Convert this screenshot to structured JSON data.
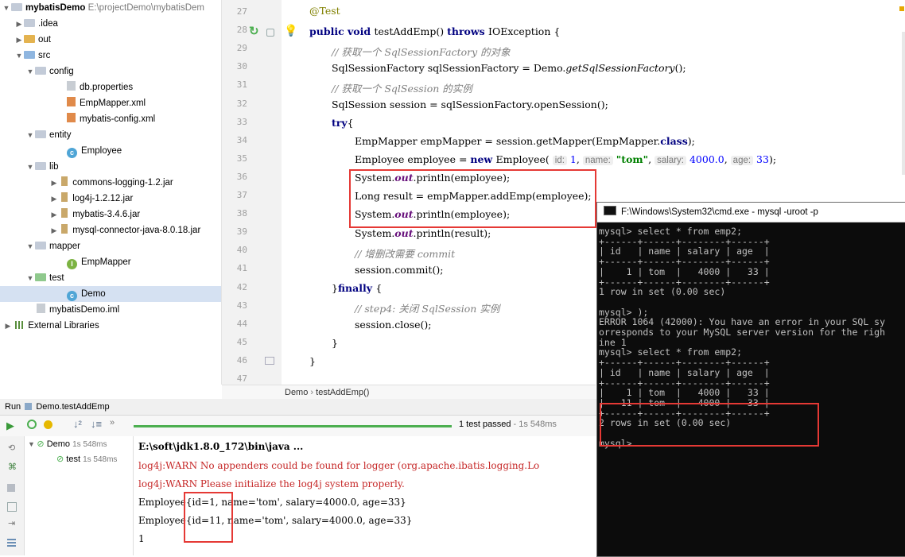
{
  "project": {
    "name": "mybatisDemo",
    "path": "E:\\projectDemo\\mybatisDem",
    "items": [
      {
        "label": ".idea"
      },
      {
        "label": "out"
      },
      {
        "label": "src"
      },
      {
        "label": "config"
      },
      {
        "label": "db.properties"
      },
      {
        "label": "EmpMapper.xml"
      },
      {
        "label": "mybatis-config.xml"
      },
      {
        "label": "entity"
      },
      {
        "label": "Employee"
      },
      {
        "label": "lib"
      },
      {
        "label": "commons-logging-1.2.jar"
      },
      {
        "label": "log4j-1.2.12.jar"
      },
      {
        "label": "mybatis-3.4.6.jar"
      },
      {
        "label": "mysql-connector-java-8.0.18.jar"
      },
      {
        "label": "mapper"
      },
      {
        "label": "EmpMapper"
      },
      {
        "label": "test"
      },
      {
        "label": "Demo"
      },
      {
        "label": "mybatisDemo.iml"
      },
      {
        "label": "External Libraries"
      }
    ]
  },
  "editor": {
    "line_numbers": [
      "27",
      "28",
      "29",
      "30",
      "31",
      "32",
      "33",
      "34",
      "35",
      "36",
      "37",
      "38",
      "39",
      "40",
      "41",
      "42",
      "43",
      "44",
      "45",
      "46",
      "47"
    ],
    "code": {
      "l27": "@Test",
      "l28a": "public void ",
      "l28b": "testAddEmp() ",
      "l28c": "throws ",
      "l28d": "IOException {",
      "l29": "// 获取一个 SqlSessionFactory 的对象",
      "l30a": "SqlSessionFactory sqlSessionFactory = Demo.",
      "l30b": "getSqlSessionFactory",
      "l30c": "();",
      "l31": "// 获取一个 SqlSession 的实例",
      "l32": "SqlSession session = sqlSessionFactory.openSession();",
      "l33a": "try",
      "l33b": "{",
      "l34a": "EmpMapper empMapper = session.getMapper(EmpMapper.",
      "l34b": "class",
      "l34c": ");",
      "l35a": "Employee employee = ",
      "l35b": "new ",
      "l35c": "Employee(",
      "h_id": "id:",
      "v_id": "1",
      "h_name": "name:",
      "v_name": "\"tom\"",
      "h_salary": "salary:",
      "v_salary": "4000.0",
      "h_age": "age:",
      "v_age": "33",
      "l35end": ");",
      "sys": "System.",
      "out": "out",
      "println_emp": ".println(employee);",
      "l37": "Long result = empMapper.addEmp(employee);",
      "println_res": ".println(result);",
      "l40": "// 增删改需要 commit",
      "l41": "session.commit();",
      "l42a": "}",
      "l42b": "finally ",
      "l42c": "{",
      "l43": "// step4: 关闭 SqlSession 实例",
      "l44": "session.close();",
      "l45": "}",
      "l46": "}"
    }
  },
  "breadcrumb": {
    "a": "Demo",
    "sep": "›",
    "b": "testAddEmp()"
  },
  "run": {
    "tab_label": "Run",
    "config": "Demo.testAddEmp",
    "status": "1 test passed",
    "status_time": " - 1s 548ms",
    "tree": [
      {
        "label": "Demo",
        "time": "1s 548ms"
      },
      {
        "label": "test",
        "time": "1s 548ms"
      }
    ],
    "console": [
      "E:\\soft\\jdk1.8.0_172\\bin\\java ...",
      "log4j:WARN No appenders could be found for logger (org.apache.ibatis.logging.Lo",
      "log4j:WARN Please initialize the log4j system properly.",
      "Employee{id=1, name='tom', salary=4000.0, age=33}",
      "Employee{id=11, name='tom', salary=4000.0, age=33}",
      "1"
    ]
  },
  "cmd": {
    "title": "F:\\Windows\\System32\\cmd.exe - mysql  -uroot -p",
    "lines": [
      "mysql> select * from emp2;",
      "+------+------+--------+------+",
      "| id   | name | salary | age  |",
      "+------+------+--------+------+",
      "|    1 | tom  |   4000 |   33 |",
      "+------+------+--------+------+",
      "1 row in set (0.00 sec)",
      "",
      "mysql> );",
      "ERROR 1064 (42000): You have an error in your SQL sy",
      "orresponds to your MySQL server version for the righ",
      "ine 1",
      "mysql> select * from emp2;",
      "+------+------+--------+------+",
      "| id   | name | salary | age  |",
      "+------+------+--------+------+",
      "|    1 | tom  |   4000 |   33 |",
      "|   11 | tom  |   4000 |   33 |",
      "+------+------+--------+------+",
      "2 rows in set (0.00 sec)",
      "",
      "mysql>"
    ]
  },
  "colors": {
    "highlight_box": "#e53935",
    "pass_green": "#4caf50",
    "cmd_bg": "#0c0c0c"
  }
}
